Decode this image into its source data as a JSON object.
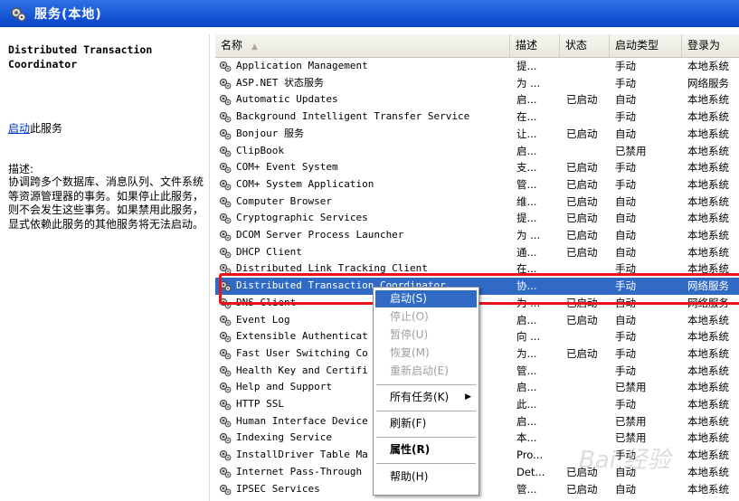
{
  "window": {
    "title": "服务(本地)"
  },
  "left_pane": {
    "service_title": "Distributed Transaction Coordinator",
    "start_link": "启动",
    "start_suffix": "此服务",
    "desc_label": "描述:",
    "description": "协调跨多个数据库、消息队列、文件系统等资源管理器的事务。如果停止此服务，则不会发生这些事务。如果禁用此服务，显式依赖此服务的其他服务将无法启动。"
  },
  "columns": [
    {
      "label": "名称"
    },
    {
      "label": "描述"
    },
    {
      "label": "状态"
    },
    {
      "label": "启动类型"
    },
    {
      "label": "登录为"
    }
  ],
  "services": [
    {
      "name": "Application Management",
      "desc": "提...",
      "status": "",
      "startup": "手动",
      "login": "本地系统"
    },
    {
      "name": "ASP.NET 状态服务",
      "desc": "为 ...",
      "status": "",
      "startup": "手动",
      "login": "网络服务"
    },
    {
      "name": "Automatic Updates",
      "desc": "启...",
      "status": "已启动",
      "startup": "自动",
      "login": "本地系统"
    },
    {
      "name": "Background Intelligent Transfer Service",
      "desc": "在...",
      "status": "",
      "startup": "手动",
      "login": "本地系统"
    },
    {
      "name": "Bonjour 服务",
      "desc": "让...",
      "status": "已启动",
      "startup": "自动",
      "login": "本地系统"
    },
    {
      "name": "ClipBook",
      "desc": "启...",
      "status": "",
      "startup": "已禁用",
      "login": "本地系统"
    },
    {
      "name": "COM+ Event System",
      "desc": "支...",
      "status": "已启动",
      "startup": "手动",
      "login": "本地系统"
    },
    {
      "name": "COM+ System Application",
      "desc": "管...",
      "status": "已启动",
      "startup": "手动",
      "login": "本地系统"
    },
    {
      "name": "Computer Browser",
      "desc": "维...",
      "status": "已启动",
      "startup": "自动",
      "login": "本地系统"
    },
    {
      "name": "Cryptographic Services",
      "desc": "提...",
      "status": "已启动",
      "startup": "自动",
      "login": "本地系统"
    },
    {
      "name": "DCOM Server Process Launcher",
      "desc": "为 ...",
      "status": "已启动",
      "startup": "自动",
      "login": "本地系统"
    },
    {
      "name": "DHCP Client",
      "desc": "通...",
      "status": "已启动",
      "startup": "自动",
      "login": "本地系统"
    },
    {
      "name": "Distributed Link Tracking Client",
      "desc": "在...",
      "status": "",
      "startup": "手动",
      "login": "本地系统"
    },
    {
      "name": "Distributed Transaction Coordinator",
      "desc": "协...",
      "status": "",
      "startup": "手动",
      "login": "网络服务",
      "selected": true
    },
    {
      "name": "DNS Client",
      "desc": "为 ...",
      "status": "已启动",
      "startup": "自动",
      "login": "网络服务"
    },
    {
      "name": "Event Log",
      "desc": "启...",
      "status": "已启动",
      "startup": "自动",
      "login": "本地系统"
    },
    {
      "name": "Extensible Authenticat",
      "desc": "向 ...",
      "status": "",
      "startup": "手动",
      "login": "本地系统"
    },
    {
      "name": "Fast User Switching Co",
      "desc": "为...",
      "status": "已启动",
      "startup": "手动",
      "login": "本地系统"
    },
    {
      "name": "Health Key and Certifi",
      "desc": "管...",
      "status": "",
      "startup": "手动",
      "login": "本地系统"
    },
    {
      "name": "Help and Support",
      "desc": "启...",
      "status": "",
      "startup": "已禁用",
      "login": "本地系统"
    },
    {
      "name": "HTTP SSL",
      "desc": "此...",
      "status": "",
      "startup": "手动",
      "login": "本地系统"
    },
    {
      "name": "Human Interface Device",
      "desc": "启...",
      "status": "",
      "startup": "已禁用",
      "login": "本地系统"
    },
    {
      "name": "Indexing Service",
      "desc": "本...",
      "status": "",
      "startup": "已禁用",
      "login": "本地系统"
    },
    {
      "name": "InstallDriver Table Ma",
      "desc": "Pro...",
      "status": "",
      "startup": "手动",
      "login": "本地系统"
    },
    {
      "name": "Internet Pass-Through",
      "desc": "Det...",
      "status": "已启动",
      "startup": "自动",
      "login": "本地系统"
    },
    {
      "name": "IPSEC Services",
      "desc": "管...",
      "status": "已启动",
      "startup": "自动",
      "login": "本地系统"
    }
  ],
  "context_menu": [
    {
      "label": "启动(S)",
      "state": "active"
    },
    {
      "label": "停止(O)",
      "state": "disabled"
    },
    {
      "label": "暂停(U)",
      "state": "disabled"
    },
    {
      "label": "恢复(M)",
      "state": "disabled"
    },
    {
      "label": "重新启动(E)",
      "state": "disabled"
    },
    {
      "label": "所有任务(K)",
      "state": "normal",
      "submenu": true
    },
    {
      "label": "刷新(F)",
      "state": "normal"
    },
    {
      "label": "属性(R)",
      "state": "bold"
    },
    {
      "label": "帮助(H)",
      "state": "normal"
    }
  ],
  "icons": {
    "title": "gear-icon",
    "service": "gear-icon",
    "submenu": "arrow-right-icon"
  },
  "colors": {
    "selection": "#316ac5",
    "highlight_box": "#e8141c",
    "titlebar": "#1555d6"
  },
  "watermark": "Bai 经验"
}
